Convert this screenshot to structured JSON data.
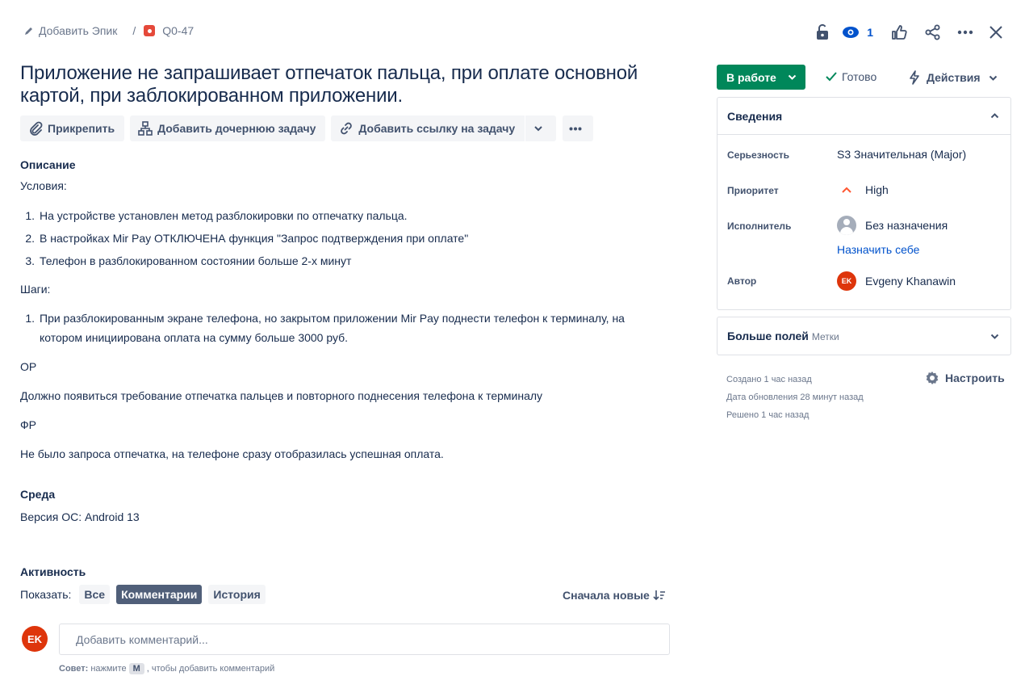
{
  "breadcrumb": {
    "add_epic": "Добавить Эпик",
    "separator": "/",
    "issue_key": "Q0-47"
  },
  "top_actions": {
    "watchers_count": "1"
  },
  "issue": {
    "title": "Приложение не запрашивает отпечаток пальца, при оплате основной картой, при заблокированном приложении."
  },
  "toolbar": {
    "attach": "Прикрепить",
    "add_child": "Добавить дочернюю задачу",
    "add_link": "Добавить ссылку на задачу"
  },
  "description": {
    "heading": "Описание",
    "conditions_label": "Условия:",
    "conditions": [
      {
        "num": "1.",
        "text": "На устройстве установлен метод разблокировки по отпечатку пальца."
      },
      {
        "num": "2.",
        "text": "В настройках Mir Pay ОТКЛЮЧЕНА функция \"Запрос подтверждения при оплате\""
      },
      {
        "num": "3.",
        "text": "Телефон в разблокированном состоянии больше 2-х минут"
      }
    ],
    "steps_label": "Шаги:",
    "steps": [
      {
        "num": "1.",
        "text": "При разблокированным экране телефона, но закрытом приложении Mir Pay поднести телефон к терминалу, на котором инициирована оплата на сумму больше 3000 руб."
      }
    ],
    "expected_label": "ОР",
    "expected_text": "Должно появиться требование отпечатка пальцев и повторного поднесения телефона к терминалу",
    "actual_label": "ФР",
    "actual_text": "Не было запроса отпечатка, на телефоне сразу отобразилась успешная оплата."
  },
  "environment": {
    "heading": "Среда",
    "text": "Версия ОС: Android 13"
  },
  "activity": {
    "heading": "Активность",
    "show_label": "Показать:",
    "filters": [
      "Все",
      "Комментарии",
      "История"
    ],
    "active_filter": "Комментарии",
    "sort_label": "Сначала новые",
    "user_initials": "EK",
    "comment_placeholder": "Добавить комментарий...",
    "tip_prefix": "Совет:",
    "tip_press": "нажмите",
    "tip_key": "M",
    "tip_suffix": ", чтобы добавить комментарий"
  },
  "side": {
    "status": "В работе",
    "done": "Готово",
    "actions": "Действия",
    "details_title": "Сведения",
    "fields": {
      "severity_label": "Серьезность",
      "severity_value": "S3 Значительная (Major)",
      "priority_label": "Приоритет",
      "priority_value": "High",
      "assignee_label": "Исполнитель",
      "assignee_value": "Без назначения",
      "assign_self": "Назначить себе",
      "author_label": "Автор",
      "author_value": "Evgeny Khanawin",
      "author_initials": "EK"
    },
    "more_fields_title": "Больше полей",
    "more_fields_sub": "Метки",
    "created": "Создано 1 час назад",
    "updated": "Дата обновления 28 минут назад",
    "resolved": "Решено 1 час назад",
    "configure": "Настроить"
  },
  "colors": {
    "status_green": "#00875a",
    "link_blue": "#0052cc",
    "avatar_red": "#de350b",
    "bug_red": "#e5493a",
    "priority_high": "#ff5630"
  }
}
